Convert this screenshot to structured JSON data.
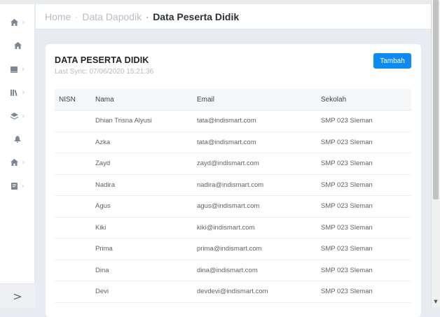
{
  "breadcrumb": {
    "home": "Home",
    "section": "Data Dapodik",
    "separator": "·",
    "current": "Data Peserta Didik"
  },
  "sidebar": {
    "items": [
      {
        "icon": "home-icon",
        "chevron": "›"
      },
      {
        "icon": "home-icon",
        "chevron": ""
      },
      {
        "icon": "book-icon",
        "chevron": "›"
      },
      {
        "icon": "library-icon",
        "chevron": "›"
      },
      {
        "icon": "layers-icon",
        "chevron": "›"
      },
      {
        "icon": "bell-icon",
        "chevron": ""
      },
      {
        "icon": "home-icon",
        "chevron": "›"
      },
      {
        "icon": "file-icon",
        "chevron": "›"
      }
    ],
    "footer_toggle": ">"
  },
  "card": {
    "title": "DATA PESERTA DIDIK",
    "subtitle": "Last Sync: 07/06/2020 15:21:36",
    "add_button": "Tambah"
  },
  "table": {
    "headers": [
      "NISN",
      "Nama",
      "Email",
      "Sekolah"
    ],
    "rows": [
      [
        "",
        "Dhian Trisna Alyusi",
        "tata@indismart.com",
        "SMP 023 Sleman"
      ],
      [
        "",
        "Azka",
        "tata@indismart.com",
        "SMP 023 Sleman"
      ],
      [
        "",
        "Zayd",
        "zayd@indismart.com",
        "SMP 023 Sleman"
      ],
      [
        "",
        "Nadira",
        "nadira@indismart.com",
        "SMP 023 Sleman"
      ],
      [
        "",
        "Agus",
        "agus@indismart.com",
        "SMP 023 Sleman"
      ],
      [
        "",
        "Kiki",
        "kiki@indismart.com",
        "SMP 023 Sleman"
      ],
      [
        "",
        "Prima",
        "prima@indismart.com",
        "SMP 023 Sleman"
      ],
      [
        "",
        "Dina",
        "dina@indismart.com",
        "SMP 023 Sleman"
      ],
      [
        "",
        "Devi",
        "devdevi@indismart.com",
        "SMP 023 Sleman"
      ]
    ]
  },
  "colors": {
    "accent": "#0d8bf2",
    "background": "#e8ebf0"
  }
}
